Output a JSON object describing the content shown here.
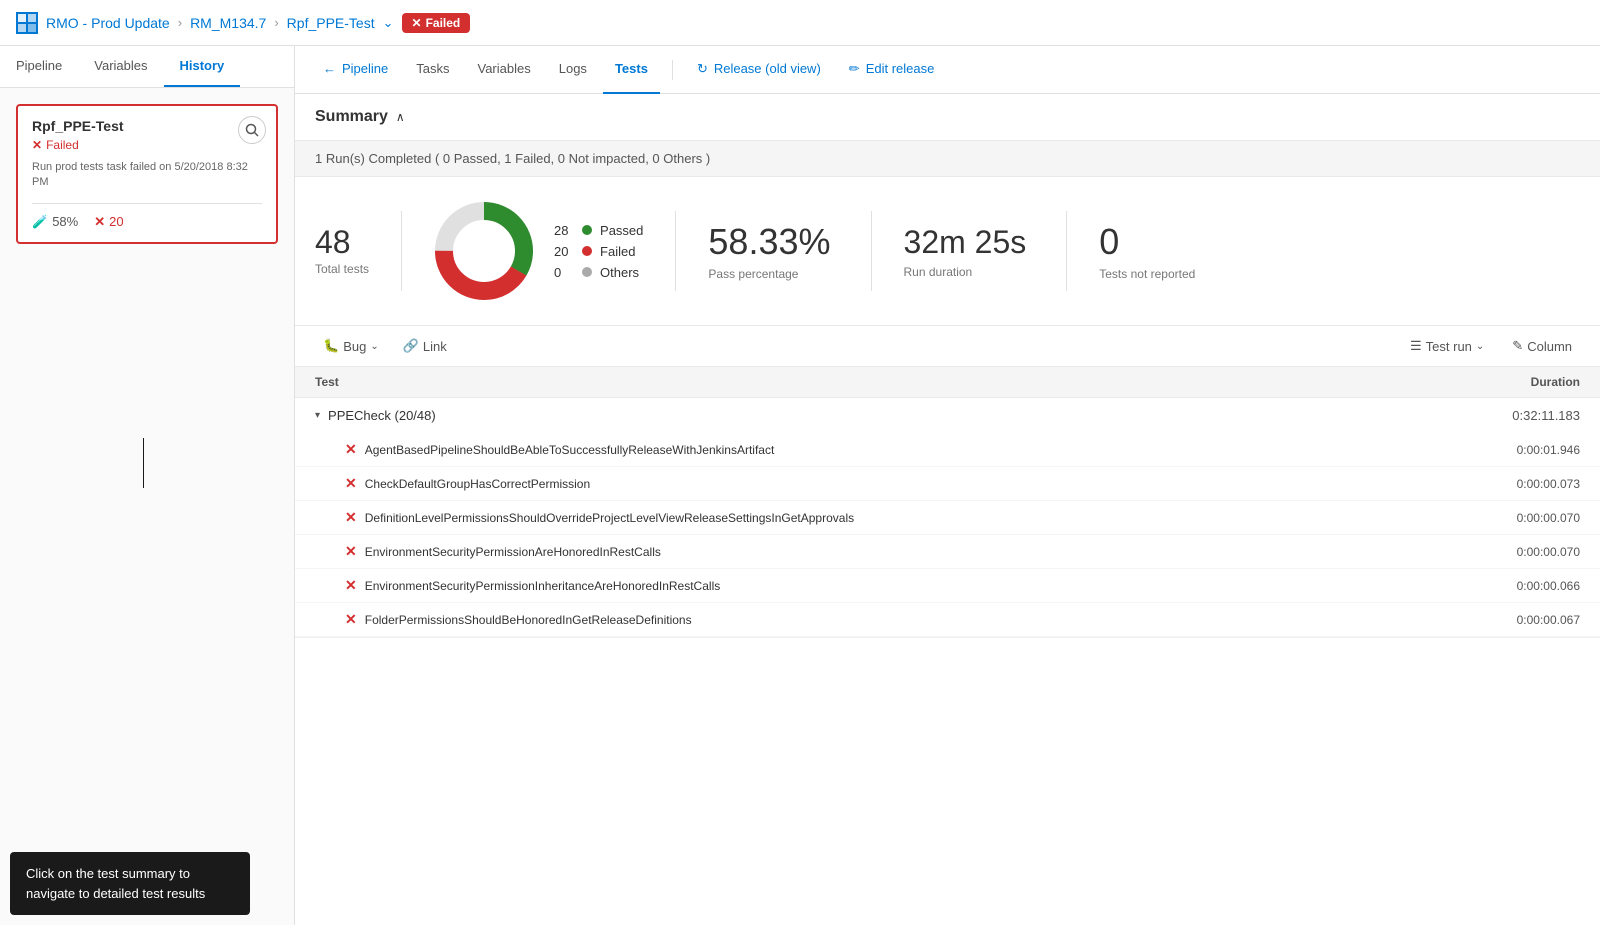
{
  "topbar": {
    "logo_text": "↑",
    "project": "RMO - Prod Update",
    "separator": ">",
    "pipeline": "RM_M134.7",
    "stage": "Rpf_PPE-Test",
    "status": "Failed",
    "status_icon": "✕"
  },
  "nav": {
    "back_label": "← Pipeline",
    "items": [
      {
        "id": "pipeline",
        "label": "Pipeline",
        "active": false
      },
      {
        "id": "tasks",
        "label": "Tasks",
        "active": false
      },
      {
        "id": "variables",
        "label": "Variables",
        "active": false
      },
      {
        "id": "logs",
        "label": "Logs",
        "active": false
      },
      {
        "id": "tests",
        "label": "Tests",
        "active": true
      }
    ],
    "release_old": "Release (old view)",
    "edit_release": "Edit release"
  },
  "sidebar": {
    "tabs": [
      {
        "id": "pipeline",
        "label": "Pipeline",
        "active": false
      },
      {
        "id": "variables",
        "label": "Variables",
        "active": false
      },
      {
        "id": "history",
        "label": "History",
        "active": true
      }
    ],
    "stage_card": {
      "title": "Rpf_PPE-Test",
      "status": "Failed",
      "desc": "Run prod tests task failed on 5/20/2018 8:32 PM",
      "pass_pct": "58%",
      "fail_count": "20"
    },
    "tooltip": "Click on the test summary to navigate to detailed test results"
  },
  "summary": {
    "title": "Summary",
    "runs_bar": "1 Run(s) Completed ( 0 Passed, 1 Failed, 0 Not impacted, 0 Others )",
    "total_tests": "48",
    "total_tests_label": "Total tests",
    "donut": {
      "passed": 28,
      "failed": 20,
      "others": 0,
      "total": 48
    },
    "legend": [
      {
        "label": "Passed",
        "count": "28",
        "color": "#2e8b2e"
      },
      {
        "label": "Failed",
        "count": "20",
        "color": "#d32f2f"
      },
      {
        "label": "Others",
        "count": "0",
        "color": "#aaa"
      }
    ],
    "pass_pct": "58.33%",
    "pass_pct_label": "Pass percentage",
    "run_duration": "32m 25s",
    "run_duration_label": "Run duration",
    "not_reported": "0",
    "not_reported_label": "Tests not reported"
  },
  "toolbar": {
    "bug_label": "Bug",
    "link_label": "Link",
    "test_run_label": "Test run",
    "column_label": "Column"
  },
  "table": {
    "headers": [
      "Test",
      "Duration"
    ],
    "groups": [
      {
        "name": "PPECheck (20/48)",
        "duration": "0:32:11.183",
        "items": [
          {
            "name": "AgentBasedPipelineShouldBeAbleToSuccessfullyReleaseWithJenkinsArtifact",
            "duration": "0:00:01.946"
          },
          {
            "name": "CheckDefaultGroupHasCorrectPermission",
            "duration": "0:00:00.073"
          },
          {
            "name": "DefinitionLevelPermissionsShouldOverrideProjectLevelViewReleaseSettingsInGetApprovals",
            "duration": "0:00:00.070"
          },
          {
            "name": "EnvironmentSecurityPermissionAreHonoredInRestCalls",
            "duration": "0:00:00.070"
          },
          {
            "name": "EnvironmentSecurityPermissionInheritanceAreHonoredInRestCalls",
            "duration": "0:00:00.066"
          },
          {
            "name": "FolderPermissionsShouldBeHonoredInGetReleaseDefinitions",
            "duration": "0:00:00.067"
          }
        ]
      }
    ]
  }
}
